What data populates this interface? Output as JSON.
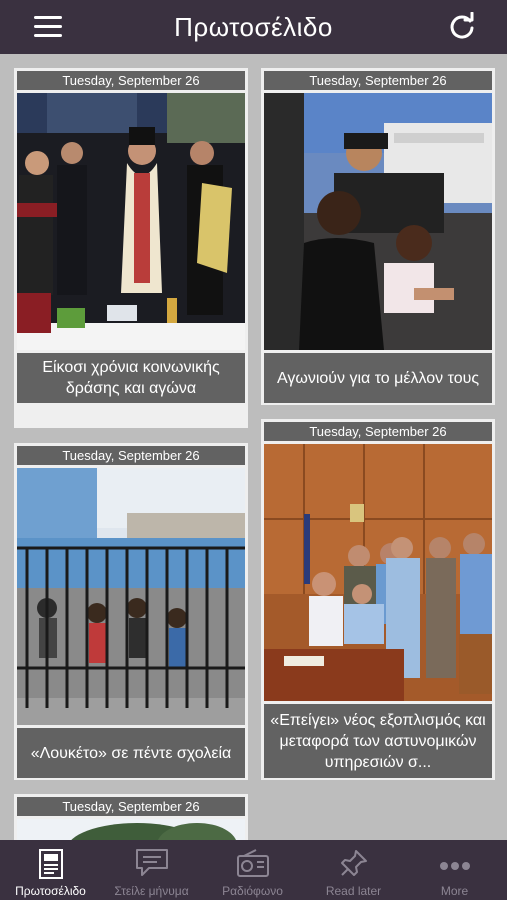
{
  "header": {
    "title": "Πρωτοσέλιδο",
    "menu_icon": "hamburger-menu-icon",
    "refresh_icon": "refresh-icon"
  },
  "articles": [
    {
      "date": "Tuesday, September 26",
      "title": "Είκοσι χρόνια κοινωνικής δράσης και αγώνα"
    },
    {
      "date": "Tuesday, September 26",
      "title": "Αγωνιούν για το μέλλον τους"
    },
    {
      "date": "Tuesday, September 26",
      "title": "«Λουκέτο» σε πέντε σχολεία"
    },
    {
      "date": "Tuesday, September 26",
      "title": "«Επείγει» νέος εξοπλισμός και μεταφορά των αστυνομικών υπηρεσιών σ..."
    },
    {
      "date": "Tuesday, September 26",
      "title": ""
    }
  ],
  "tabs": [
    {
      "label": "Πρωτοσέλιδο",
      "icon": "newspaper-icon",
      "active": true
    },
    {
      "label": "Στείλε μήνυμα",
      "icon": "message-icon",
      "active": false
    },
    {
      "label": "Ραδιόφωνο",
      "icon": "radio-icon",
      "active": false
    },
    {
      "label": "Read later",
      "icon": "pin-icon",
      "active": false
    },
    {
      "label": "More",
      "icon": "more-dots-icon",
      "active": false
    }
  ],
  "colors": {
    "bar": "#3a3140",
    "background": "#bdbdbd",
    "card": "#efefef",
    "label": "#626262",
    "tab_inactive": "#8c8593"
  }
}
